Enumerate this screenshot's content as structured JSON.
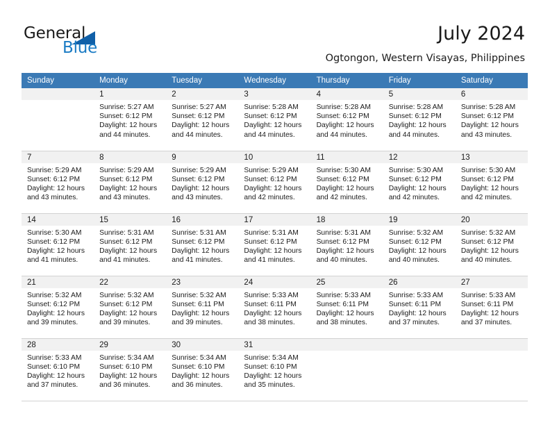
{
  "brand": {
    "name_part1": "General",
    "name_part2": "Blue",
    "accent_color": "#1a7bc4",
    "triangle_color": "#1060a8",
    "triangle_icon": "triangle-icon"
  },
  "header": {
    "title": "July 2024",
    "subtitle": "Ogtongon, Western Visayas, Philippines",
    "header_bg": "#3b7ab5",
    "daynum_band_bg": "#f1f1f1"
  },
  "weekdays": [
    "Sunday",
    "Monday",
    "Tuesday",
    "Wednesday",
    "Thursday",
    "Friday",
    "Saturday"
  ],
  "weeks": [
    [
      {
        "day": "",
        "empty": true
      },
      {
        "day": "1",
        "sunrise": "Sunrise: 5:27 AM",
        "sunset": "Sunset: 6:12 PM",
        "daylight_line1": "Daylight: 12 hours",
        "daylight_line2": "and 44 minutes."
      },
      {
        "day": "2",
        "sunrise": "Sunrise: 5:27 AM",
        "sunset": "Sunset: 6:12 PM",
        "daylight_line1": "Daylight: 12 hours",
        "daylight_line2": "and 44 minutes."
      },
      {
        "day": "3",
        "sunrise": "Sunrise: 5:28 AM",
        "sunset": "Sunset: 6:12 PM",
        "daylight_line1": "Daylight: 12 hours",
        "daylight_line2": "and 44 minutes."
      },
      {
        "day": "4",
        "sunrise": "Sunrise: 5:28 AM",
        "sunset": "Sunset: 6:12 PM",
        "daylight_line1": "Daylight: 12 hours",
        "daylight_line2": "and 44 minutes."
      },
      {
        "day": "5",
        "sunrise": "Sunrise: 5:28 AM",
        "sunset": "Sunset: 6:12 PM",
        "daylight_line1": "Daylight: 12 hours",
        "daylight_line2": "and 44 minutes."
      },
      {
        "day": "6",
        "sunrise": "Sunrise: 5:28 AM",
        "sunset": "Sunset: 6:12 PM",
        "daylight_line1": "Daylight: 12 hours",
        "daylight_line2": "and 43 minutes."
      }
    ],
    [
      {
        "day": "7",
        "sunrise": "Sunrise: 5:29 AM",
        "sunset": "Sunset: 6:12 PM",
        "daylight_line1": "Daylight: 12 hours",
        "daylight_line2": "and 43 minutes."
      },
      {
        "day": "8",
        "sunrise": "Sunrise: 5:29 AM",
        "sunset": "Sunset: 6:12 PM",
        "daylight_line1": "Daylight: 12 hours",
        "daylight_line2": "and 43 minutes."
      },
      {
        "day": "9",
        "sunrise": "Sunrise: 5:29 AM",
        "sunset": "Sunset: 6:12 PM",
        "daylight_line1": "Daylight: 12 hours",
        "daylight_line2": "and 43 minutes."
      },
      {
        "day": "10",
        "sunrise": "Sunrise: 5:29 AM",
        "sunset": "Sunset: 6:12 PM",
        "daylight_line1": "Daylight: 12 hours",
        "daylight_line2": "and 42 minutes."
      },
      {
        "day": "11",
        "sunrise": "Sunrise: 5:30 AM",
        "sunset": "Sunset: 6:12 PM",
        "daylight_line1": "Daylight: 12 hours",
        "daylight_line2": "and 42 minutes."
      },
      {
        "day": "12",
        "sunrise": "Sunrise: 5:30 AM",
        "sunset": "Sunset: 6:12 PM",
        "daylight_line1": "Daylight: 12 hours",
        "daylight_line2": "and 42 minutes."
      },
      {
        "day": "13",
        "sunrise": "Sunrise: 5:30 AM",
        "sunset": "Sunset: 6:12 PM",
        "daylight_line1": "Daylight: 12 hours",
        "daylight_line2": "and 42 minutes."
      }
    ],
    [
      {
        "day": "14",
        "sunrise": "Sunrise: 5:30 AM",
        "sunset": "Sunset: 6:12 PM",
        "daylight_line1": "Daylight: 12 hours",
        "daylight_line2": "and 41 minutes."
      },
      {
        "day": "15",
        "sunrise": "Sunrise: 5:31 AM",
        "sunset": "Sunset: 6:12 PM",
        "daylight_line1": "Daylight: 12 hours",
        "daylight_line2": "and 41 minutes."
      },
      {
        "day": "16",
        "sunrise": "Sunrise: 5:31 AM",
        "sunset": "Sunset: 6:12 PM",
        "daylight_line1": "Daylight: 12 hours",
        "daylight_line2": "and 41 minutes."
      },
      {
        "day": "17",
        "sunrise": "Sunrise: 5:31 AM",
        "sunset": "Sunset: 6:12 PM",
        "daylight_line1": "Daylight: 12 hours",
        "daylight_line2": "and 41 minutes."
      },
      {
        "day": "18",
        "sunrise": "Sunrise: 5:31 AM",
        "sunset": "Sunset: 6:12 PM",
        "daylight_line1": "Daylight: 12 hours",
        "daylight_line2": "and 40 minutes."
      },
      {
        "day": "19",
        "sunrise": "Sunrise: 5:32 AM",
        "sunset": "Sunset: 6:12 PM",
        "daylight_line1": "Daylight: 12 hours",
        "daylight_line2": "and 40 minutes."
      },
      {
        "day": "20",
        "sunrise": "Sunrise: 5:32 AM",
        "sunset": "Sunset: 6:12 PM",
        "daylight_line1": "Daylight: 12 hours",
        "daylight_line2": "and 40 minutes."
      }
    ],
    [
      {
        "day": "21",
        "sunrise": "Sunrise: 5:32 AM",
        "sunset": "Sunset: 6:12 PM",
        "daylight_line1": "Daylight: 12 hours",
        "daylight_line2": "and 39 minutes."
      },
      {
        "day": "22",
        "sunrise": "Sunrise: 5:32 AM",
        "sunset": "Sunset: 6:12 PM",
        "daylight_line1": "Daylight: 12 hours",
        "daylight_line2": "and 39 minutes."
      },
      {
        "day": "23",
        "sunrise": "Sunrise: 5:32 AM",
        "sunset": "Sunset: 6:11 PM",
        "daylight_line1": "Daylight: 12 hours",
        "daylight_line2": "and 39 minutes."
      },
      {
        "day": "24",
        "sunrise": "Sunrise: 5:33 AM",
        "sunset": "Sunset: 6:11 PM",
        "daylight_line1": "Daylight: 12 hours",
        "daylight_line2": "and 38 minutes."
      },
      {
        "day": "25",
        "sunrise": "Sunrise: 5:33 AM",
        "sunset": "Sunset: 6:11 PM",
        "daylight_line1": "Daylight: 12 hours",
        "daylight_line2": "and 38 minutes."
      },
      {
        "day": "26",
        "sunrise": "Sunrise: 5:33 AM",
        "sunset": "Sunset: 6:11 PM",
        "daylight_line1": "Daylight: 12 hours",
        "daylight_line2": "and 37 minutes."
      },
      {
        "day": "27",
        "sunrise": "Sunrise: 5:33 AM",
        "sunset": "Sunset: 6:11 PM",
        "daylight_line1": "Daylight: 12 hours",
        "daylight_line2": "and 37 minutes."
      }
    ],
    [
      {
        "day": "28",
        "sunrise": "Sunrise: 5:33 AM",
        "sunset": "Sunset: 6:10 PM",
        "daylight_line1": "Daylight: 12 hours",
        "daylight_line2": "and 37 minutes."
      },
      {
        "day": "29",
        "sunrise": "Sunrise: 5:34 AM",
        "sunset": "Sunset: 6:10 PM",
        "daylight_line1": "Daylight: 12 hours",
        "daylight_line2": "and 36 minutes."
      },
      {
        "day": "30",
        "sunrise": "Sunrise: 5:34 AM",
        "sunset": "Sunset: 6:10 PM",
        "daylight_line1": "Daylight: 12 hours",
        "daylight_line2": "and 36 minutes."
      },
      {
        "day": "31",
        "sunrise": "Sunrise: 5:34 AM",
        "sunset": "Sunset: 6:10 PM",
        "daylight_line1": "Daylight: 12 hours",
        "daylight_line2": "and 35 minutes."
      },
      {
        "day": "",
        "empty": true
      },
      {
        "day": "",
        "empty": true
      },
      {
        "day": "",
        "empty": true
      }
    ]
  ]
}
